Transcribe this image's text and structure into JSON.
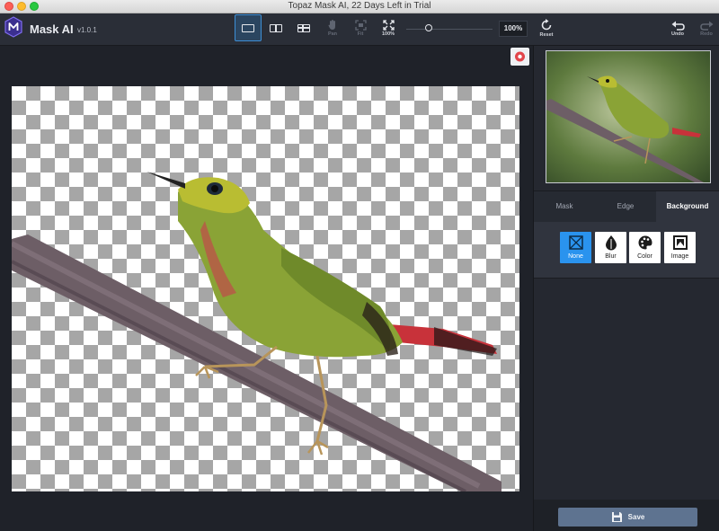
{
  "window": {
    "title": "Topaz Mask AI, 22 Days Left in Trial"
  },
  "app": {
    "name": "Mask AI",
    "version": "v1.0.1"
  },
  "toolbar": {
    "views": [
      {
        "icon": "single-view-icon",
        "active": true
      },
      {
        "icon": "split-view-icon",
        "active": false
      },
      {
        "icon": "side-by-side-view-icon",
        "active": false
      }
    ],
    "pan_label": "Pan",
    "fit_label": "Fit",
    "zoom100_label": "100%",
    "zoom_value": "100%",
    "reset_label": "Reset",
    "undo_label": "Undo",
    "redo_label": "Redo"
  },
  "panel": {
    "tabs": [
      "Mask",
      "Edge",
      "Background"
    ],
    "active_tab": "Background",
    "background_options": [
      {
        "label": "None",
        "icon": "none-icon",
        "selected": true
      },
      {
        "label": "Blur",
        "icon": "blur-icon",
        "selected": false
      },
      {
        "label": "Color",
        "icon": "palette-icon",
        "selected": false
      },
      {
        "label": "Image",
        "icon": "image-icon",
        "selected": false
      }
    ],
    "save_label": "Save"
  },
  "colors": {
    "accent": "#2a93ee",
    "active_view_border": "#3d8fd6",
    "save_button": "#5e7390"
  }
}
